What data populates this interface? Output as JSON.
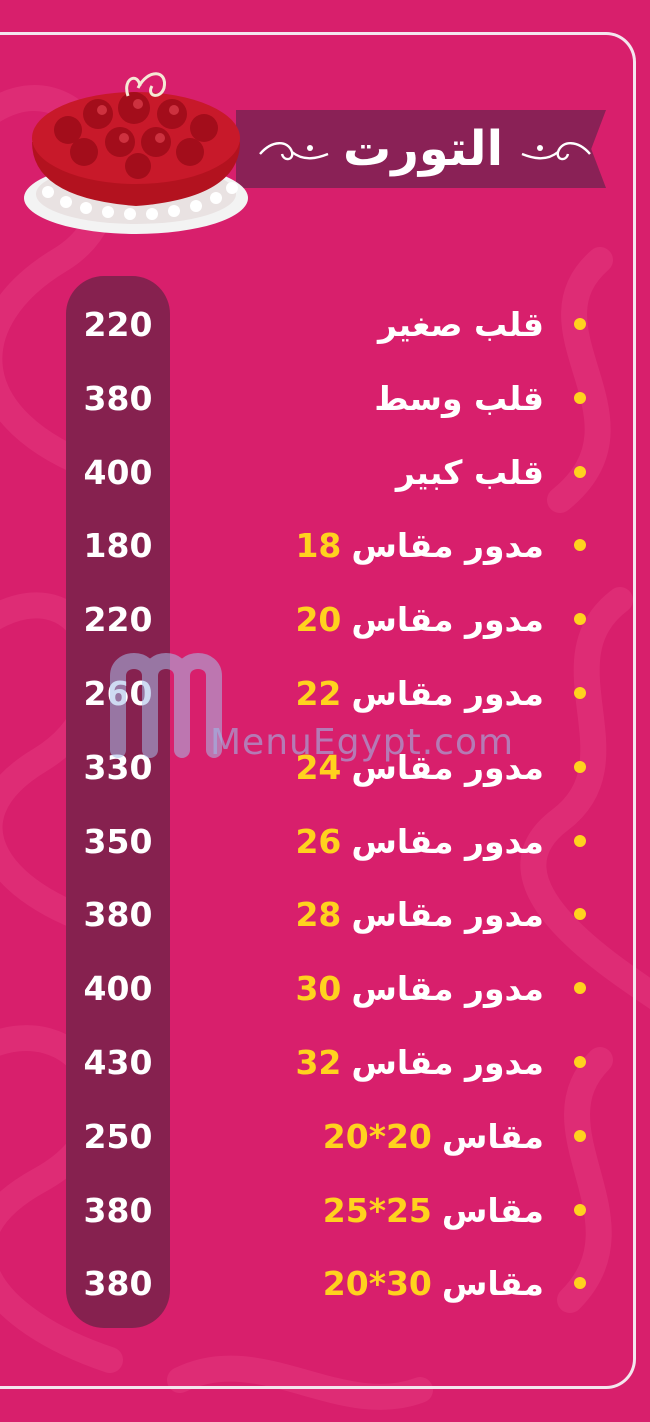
{
  "title": "التورت",
  "watermark": "MenuEgypt.com",
  "colors": {
    "background": "#d81f6c",
    "banner": "#8a2156",
    "price_pill": "#86214f",
    "accent_yellow": "#ffd21e",
    "text": "#ffffff"
  },
  "items": [
    {
      "name": "قلب صغير",
      "size": "",
      "price": "220"
    },
    {
      "name": "قلب وسط",
      "size": "",
      "price": "380"
    },
    {
      "name": "قلب كبير",
      "size": "",
      "price": "400"
    },
    {
      "name": "مدور مقاس",
      "size": "18",
      "price": "180"
    },
    {
      "name": "مدور مقاس",
      "size": "20",
      "price": "220"
    },
    {
      "name": "مدور مقاس",
      "size": "22",
      "price": "260"
    },
    {
      "name": "مدور مقاس",
      "size": "24",
      "price": "330"
    },
    {
      "name": "مدور مقاس",
      "size": "26",
      "price": "350"
    },
    {
      "name": "مدور مقاس",
      "size": "28",
      "price": "380"
    },
    {
      "name": "مدور مقاس",
      "size": "30",
      "price": "400"
    },
    {
      "name": "مدور مقاس",
      "size": "32",
      "price": "430"
    },
    {
      "name": "مقاس",
      "size": "20*20",
      "price": "250"
    },
    {
      "name": "مقاس",
      "size": "25*25",
      "price": "380"
    },
    {
      "name": "مقاس",
      "size": "20*30",
      "price": "380"
    }
  ]
}
